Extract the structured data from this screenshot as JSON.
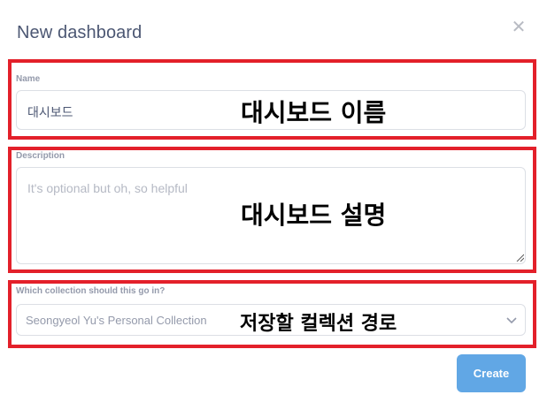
{
  "dialog": {
    "title": "New dashboard",
    "close_icon": "close-icon"
  },
  "name_section": {
    "label": "Name",
    "value": "대시보드",
    "annotation": "대시보드 이름"
  },
  "description_section": {
    "label": "Description",
    "placeholder": "It's optional but oh, so helpful",
    "annotation": "대시보드 설명"
  },
  "collection_section": {
    "label": "Which collection should this go in?",
    "selected": "Seongyeol Yu's Personal Collection",
    "annotation": "저장할 컬렉션 경로",
    "dropdown_icon": "chevron-down-icon"
  },
  "footer": {
    "create_label": "Create"
  },
  "colors": {
    "annotation_border": "#e3202a",
    "primary_button": "#509ee3"
  }
}
